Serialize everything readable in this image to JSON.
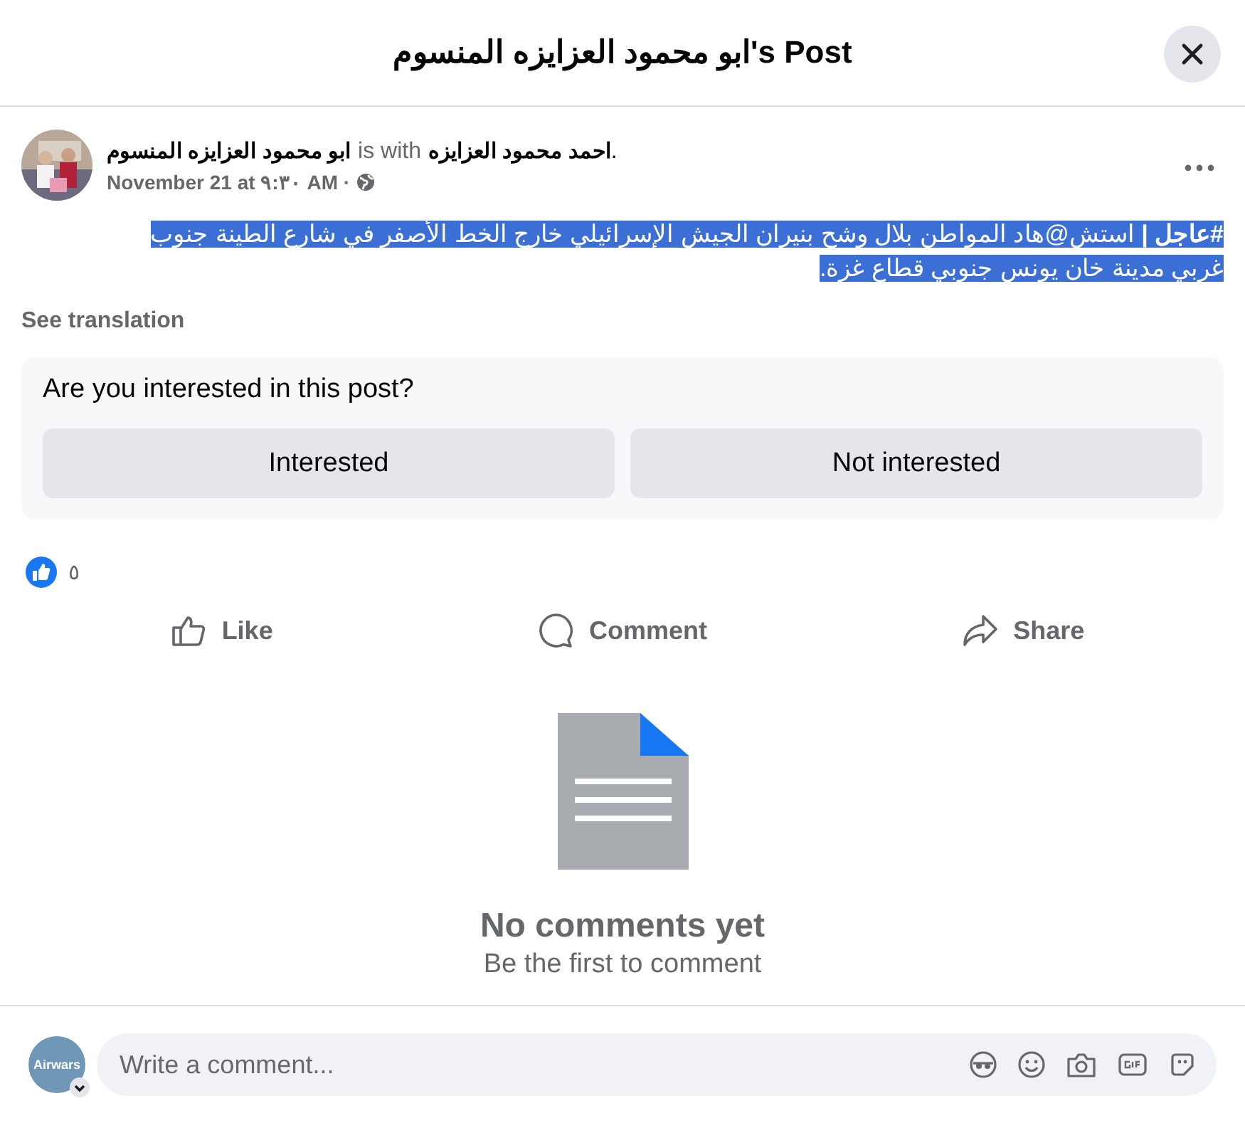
{
  "header": {
    "title": "ابو محمود العزايزه المنسوم's Post"
  },
  "post": {
    "author": "ابو محمود العزايزه المنسوم",
    "with_text": "is with",
    "tagged": "احمد محمود العزايزه",
    "tagged_end": ".",
    "date": "November 21 at ٩:٣٠ AM ·",
    "text": "**#عاجل |** استش@هاد المواطن بلال وشح بنيران الجيش الإسرائيلي خارج الخط الأصفر في شارع الطينة جنوب غربي مدينة خان يونس جنوبي قطاع غزة.",
    "highlighted": true,
    "see_translation": "See translation"
  },
  "interest": {
    "question": "Are you interested in this post?",
    "interested_button": "Interested",
    "not_interested_button": "Not interested"
  },
  "reactions": {
    "count": "٥"
  },
  "actions": {
    "like": "Like",
    "comment": "Comment",
    "share": "Share"
  },
  "comments": {
    "empty_title": "No comments yet",
    "empty_subtitle": "Be the first to comment"
  },
  "composer": {
    "avatar_label": "Airwars",
    "placeholder": "Write a comment..."
  }
}
